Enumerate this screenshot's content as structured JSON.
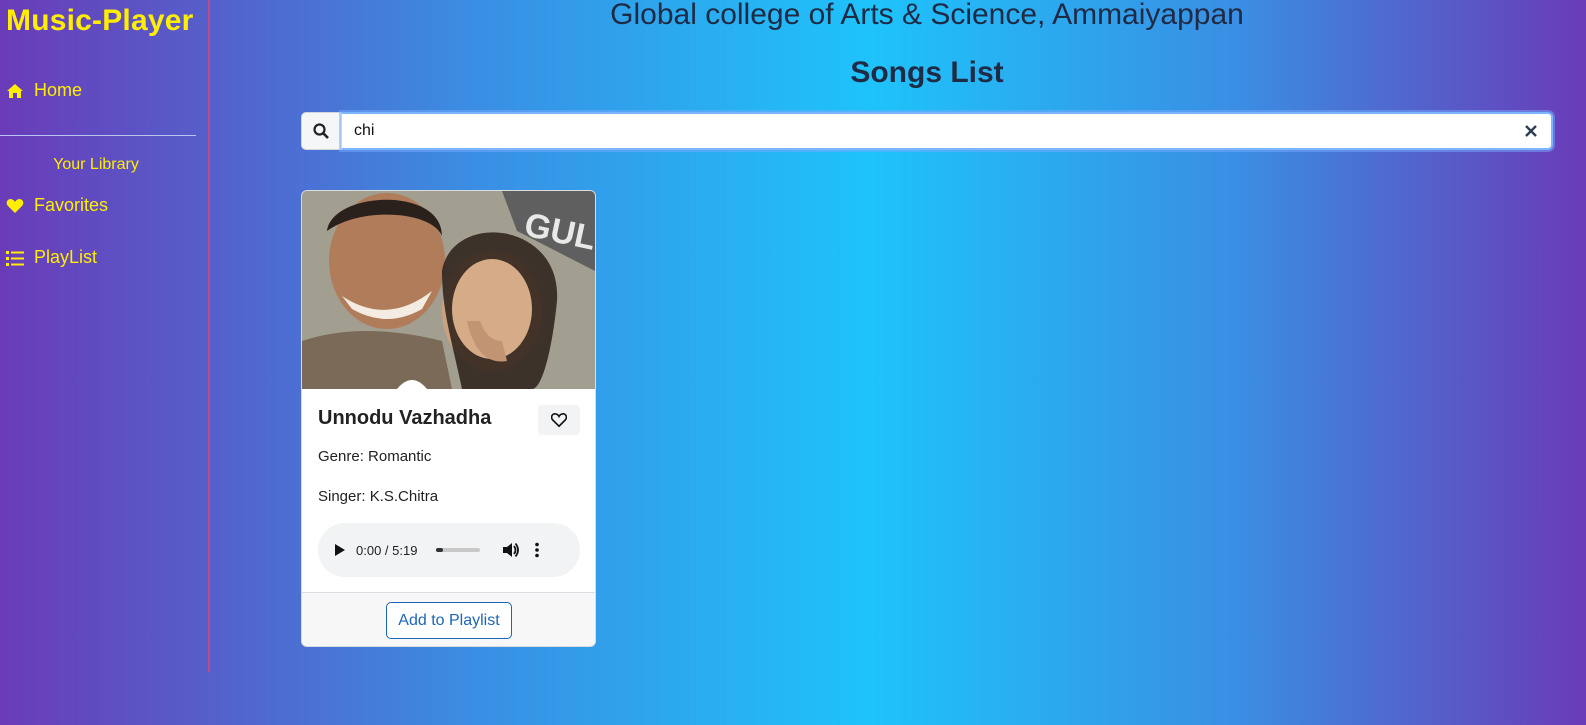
{
  "sidebar": {
    "brand": "Music-Player",
    "home_label": "Home",
    "library_label": "Your Library",
    "favorites_label": "Favorites",
    "playlist_label": "PlayList"
  },
  "header": {
    "college": "Global college of Arts & Science, Ammaiyappan",
    "title": "Songs List"
  },
  "search": {
    "value": "chi"
  },
  "songs": [
    {
      "title": "Unnodu Vazhadha",
      "genre": "Genre: Romantic",
      "singer": "Singer: K.S.Chitra",
      "time": "0:00 / 5:19",
      "progress": 0.15,
      "add_label": "Add to Playlist"
    }
  ],
  "colors": {
    "accent": "#ffee00",
    "button": "#1c66b8"
  },
  "icons": [
    "home-icon",
    "heart-icon",
    "list-icon",
    "search-icon",
    "close-icon",
    "play-icon",
    "volume-icon",
    "more-icon"
  ]
}
